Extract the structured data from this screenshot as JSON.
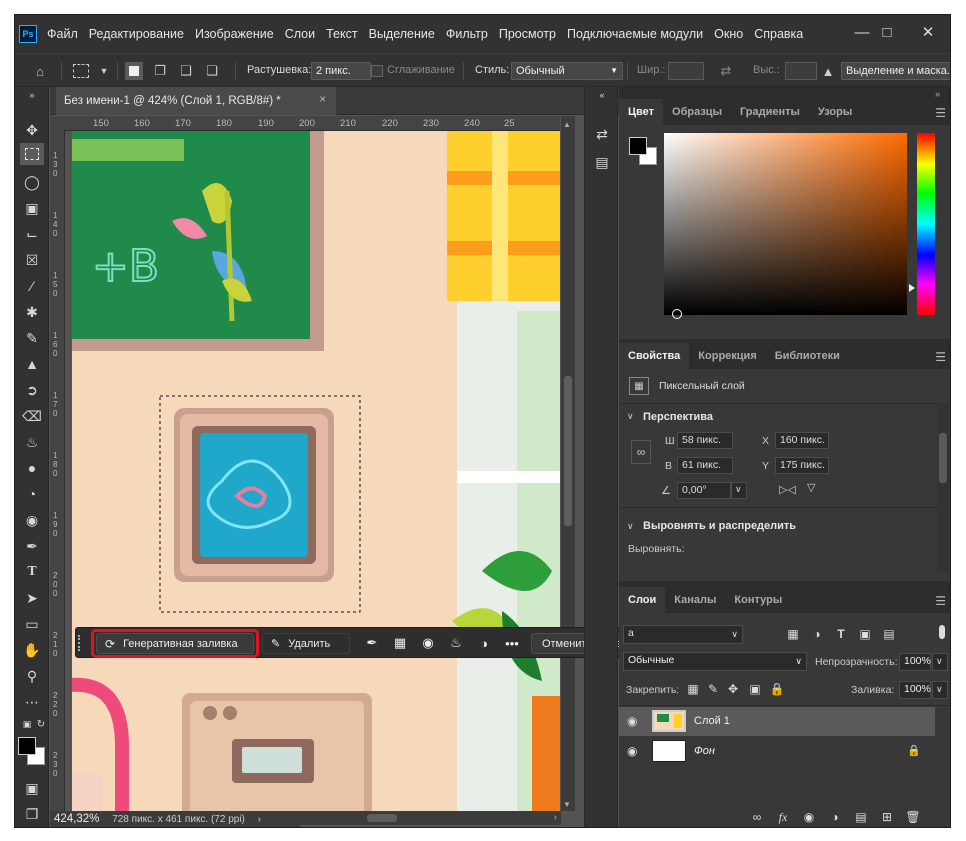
{
  "app": {
    "logo": "Ps"
  },
  "menu": [
    "Файл",
    "Редактирование",
    "Изображение",
    "Слои",
    "Текст",
    "Выделение",
    "Фильтр",
    "Просмотр",
    "Подключаемые модули",
    "Окно",
    "Справка"
  ],
  "window": {
    "minimize_icon": "minimize-icon",
    "maximize_icon": "maximize-icon",
    "close_icon": "close-icon"
  },
  "options": {
    "feather_label": "Растушевка:",
    "feather_value": "2 пикс.",
    "antialias_label": "Сглаживание",
    "style_label": "Стиль:",
    "style_value": "Обычный",
    "width_label": "Шир.:",
    "height_label": "Выс.:",
    "select_mask": "Выделение и маска..."
  },
  "document": {
    "tab_title": "Без имени-1 @ 424% (Слой 1, RGB/8#) *",
    "close": "×",
    "zoom": "424,32%",
    "info": "728 пикс. x 461 пикс. (72 ppi)",
    "status_arrow": "›"
  },
  "ruler": {
    "h": [
      "150",
      "160",
      "170",
      "180",
      "190",
      "200",
      "210",
      "220",
      "230",
      "240",
      "25"
    ],
    "v": [
      "130",
      "140",
      "150",
      "160",
      "170",
      "180",
      "190",
      "200",
      "210",
      "220",
      "230"
    ]
  },
  "context_bar": {
    "generative_fill": "Генеративная заливка",
    "delete": "Удалить",
    "deselect": "Отменить выделение",
    "more": "•••"
  },
  "color_panel": {
    "tabs": [
      "Цвет",
      "Образцы",
      "Градиенты",
      "Узоры"
    ]
  },
  "properties": {
    "tabs": [
      "Свойства",
      "Коррекция",
      "Библиотеки"
    ],
    "layer_type": "Пиксельный слой",
    "perspective_title": "Перспектива",
    "w_label": "Ш",
    "w_value": "58 пикс.",
    "h_label": "В",
    "h_value": "61 пикс.",
    "x_label": "X",
    "x_value": "160 пикс.",
    "y_label": "Y",
    "y_value": "175 пикс.",
    "angle_value": "0,00°",
    "align_title": "Выровнять и распределить",
    "align_label": "Выровнять:"
  },
  "layers_panel": {
    "tabs": [
      "Слои",
      "Каналы",
      "Контуры"
    ],
    "filter_value": "а",
    "blend_mode": "Обычные",
    "opacity_label": "Непрозрачность:",
    "opacity_value": "100%",
    "lock_label": "Закрепить:",
    "fill_label": "Заливка:",
    "fill_value": "100%",
    "layers": [
      {
        "name": "Слой 1"
      },
      {
        "name": "Фон"
      }
    ]
  }
}
